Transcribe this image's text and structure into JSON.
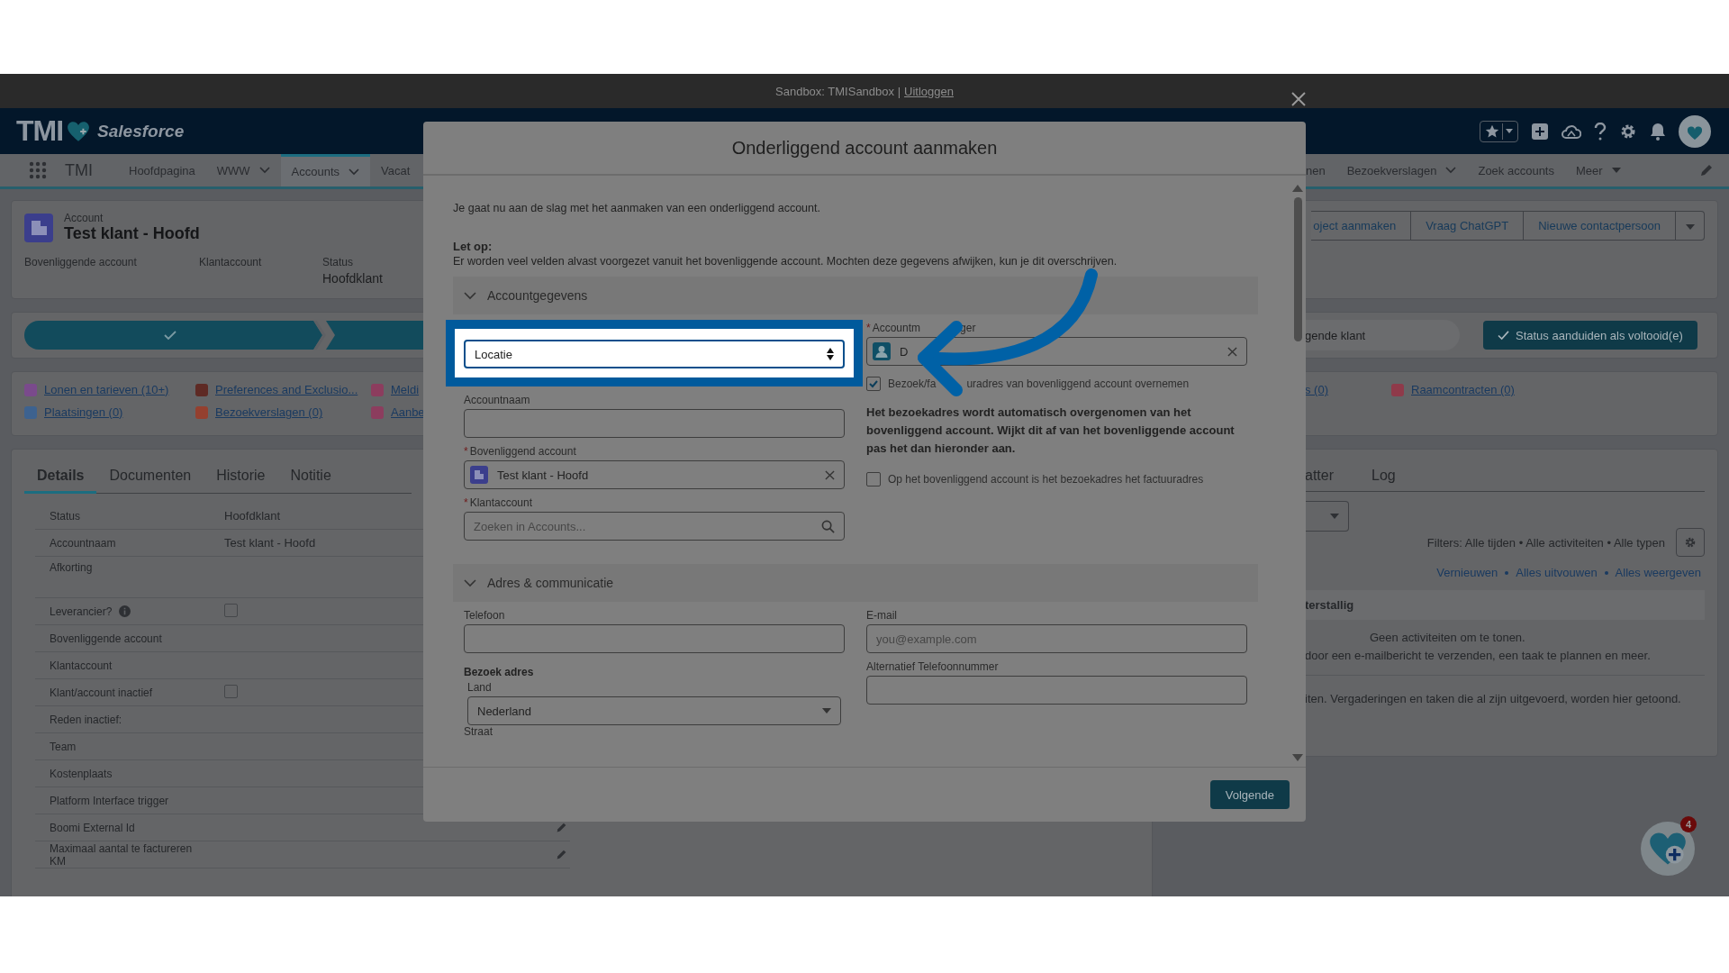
{
  "sandbox_bar": {
    "text": "Sandbox: TMISandbox |",
    "logout_link": "Uitloggen"
  },
  "header": {
    "logo_text": "TMI",
    "brand": "Salesforce"
  },
  "nav": {
    "app_name": "TMI",
    "items_left": [
      {
        "label": "Hoofdpagina",
        "kind": "plain",
        "selected": false
      },
      {
        "label": "WWW",
        "kind": "chevron",
        "selected": false
      },
      {
        "label": "Accounts",
        "kind": "chevron",
        "selected": true
      },
      {
        "label": "Vacat",
        "kind": "plain",
        "selected": false
      }
    ],
    "items_right": [
      {
        "label": "nen",
        "kind": "plain",
        "selected": false
      },
      {
        "label": "Bezoekverslagen",
        "kind": "chevron",
        "selected": false
      },
      {
        "label": "Zoek accounts",
        "kind": "plain",
        "selected": false
      },
      {
        "label": "Meer",
        "kind": "triangle",
        "selected": false
      }
    ]
  },
  "record": {
    "type_label": "Account",
    "name": "Test klant - Hoofd",
    "fields": [
      {
        "label": "Bovenliggende account"
      },
      {
        "label": "Klantaccount"
      },
      {
        "label": "Status",
        "value": "Hoofdklant"
      }
    ],
    "actions": [
      "oject aanmaken",
      "Vraag ChatGPT",
      "Nieuwe contactpersoon"
    ]
  },
  "path": {
    "current_stage": "gende klant",
    "complete_button": "Status aanduiden als voltooid(e)"
  },
  "related_links": {
    "left": [
      {
        "label": "Lonen en tarieven (10+)",
        "color": "#7a4a8c"
      },
      {
        "label": "Preferences and Exclusio...",
        "color": "#5e2a24"
      },
      {
        "label": "Meldi",
        "color": "#8c3d5e"
      },
      {
        "label": "Plaatsingen (0)",
        "color": "#3d628f"
      },
      {
        "label": "Bezoekverslagen (0)",
        "color": "#94402f"
      },
      {
        "label": "Aanbe",
        "color": "#8c3d5e"
      }
    ],
    "right": [
      {
        "label": "s (0)"
      },
      {
        "label": "Raamcontracten (0)",
        "color": "#8f3a4a"
      }
    ]
  },
  "details": {
    "tabs": [
      {
        "label": "Details",
        "selected": true
      },
      {
        "label": "Documenten",
        "selected": false
      },
      {
        "label": "Historie",
        "selected": false
      },
      {
        "label": "Notitie",
        "selected": false
      }
    ],
    "rows": [
      {
        "label": "Status",
        "value": "Hoofdklant"
      },
      {
        "label": "Accountnaam",
        "value": "Test klant - Hoofd"
      },
      {
        "label": "Afkorting"
      },
      {
        "label": "Leverancier?",
        "info": true,
        "kind": "checkbox",
        "checked": false
      },
      {
        "label": "Bovenliggende account"
      },
      {
        "label": "Klantaccount"
      },
      {
        "label": "Klant/account inactief",
        "kind": "checkbox",
        "checked": false
      },
      {
        "label": "Reden inactief:"
      },
      {
        "label": "Team"
      },
      {
        "label": "Kostenplaats"
      },
      {
        "label": "Platform Interface trigger"
      },
      {
        "label": "Boomi External Id",
        "editable": true
      },
      {
        "label": "Maximaal aantal te factureren KM",
        "editable": true
      }
    ]
  },
  "activity": {
    "tabs": [
      {
        "label": "atter",
        "selected": false
      },
      {
        "label": "Log",
        "selected": false
      }
    ],
    "filters": "Filters: Alle tijden • Alle activiteiten • Alle typen",
    "links": [
      "Vernieuwen",
      "Alles uitvouwen",
      "Alles weergeven"
    ],
    "section": "terstallig",
    "empty_title": "Geen activiteiten om te tonen.",
    "empty_hint": "door een e-mailbericht te verzenden, een taak te plannen en meer.",
    "past_note": "iten. Vergaderingen en taken die al zijn uitgevoerd, worden hier getoond."
  },
  "floating_button": {
    "badge": "4"
  },
  "modal": {
    "title": "Onderliggend account aanmaken",
    "intro": "Je gaat nu aan de slag met het aanmaken van een onderliggend account.",
    "note_title": "Let op:",
    "note": "Er worden veel velden alvast voorgezet vanuit het bovenliggende account. Mochten deze gegevens afwijken, kun je dit overschrijven.",
    "sections": [
      {
        "title": "Accountgegevens",
        "expanded": true
      },
      {
        "title": "Adres & communicatie",
        "expanded": true
      }
    ],
    "account_structure": {
      "value": "Locatie",
      "highlighted": true
    },
    "account_name": {
      "label": "Accountnaam"
    },
    "parent_account": {
      "label": "Bovenliggend account",
      "required_mark": "*",
      "value": "Test klant - Hoofd"
    },
    "customer_account": {
      "label": "Klantaccount",
      "required_mark": "*",
      "placeholder": "Zoeken in Accounts..."
    },
    "account_manager": {
      "label_parts": [
        "Accountm",
        "ger"
      ],
      "required_mark": "*",
      "value": "D"
    },
    "copy_address": {
      "label_parts": [
        "Bezoek/fa",
        "uradres van bovenliggend account overnemen"
      ],
      "checked": true
    },
    "copy_info": "Het bezoekadres wordt automatisch overgenomen van het bovenliggend account. Wijkt dit af van het bovenliggende account pas het dan hieronder aan.",
    "visit_is_invoice": {
      "label": "Op het bovenliggend account is het bezoekadres het factuuradres",
      "checked": false
    },
    "phone": {
      "label": "Telefoon"
    },
    "email": {
      "label": "E-mail",
      "placeholder": "you@example.com"
    },
    "visit_address_heading": "Bezoek adres",
    "country": {
      "label": "Land",
      "value": "Nederland"
    },
    "alt_phone": {
      "label": "Alternatief Telefoonnummer"
    },
    "street": {
      "label": "Straat"
    },
    "next_button": "Volgende"
  }
}
